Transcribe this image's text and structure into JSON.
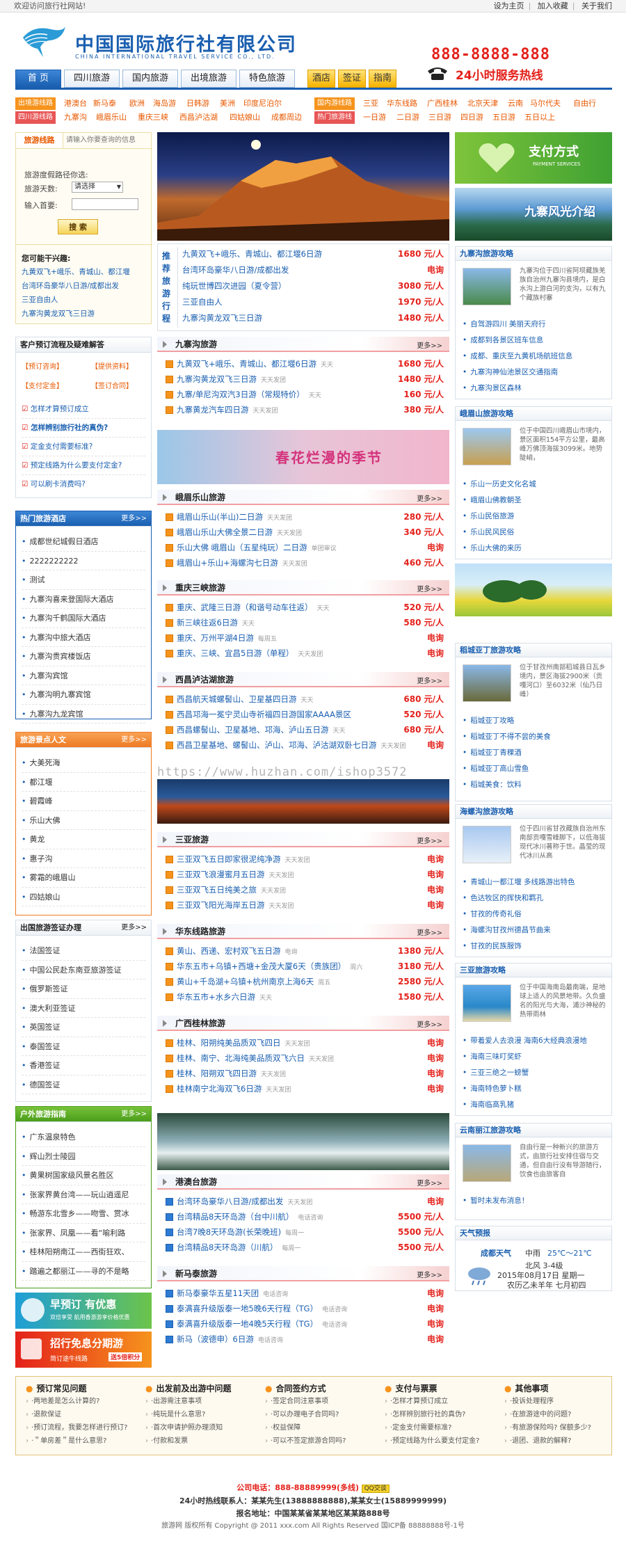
{
  "topbar": {
    "welcome": "欢迎访问旅行社网站!",
    "links": [
      "设为主页",
      "加入收藏",
      "关于我们"
    ]
  },
  "header": {
    "title_cn": "中国国际旅行社有限公司",
    "title_en": "CHINA INTERNATIONAL TRAVEL SERVICE CO., LTD.",
    "phone": "888-8888-888",
    "phone_label": "24小时服务热线"
  },
  "nav": [
    "首 页",
    "四川旅游",
    "国内旅游",
    "出境旅游",
    "特色旅游",
    "酒店",
    "签证",
    "指南"
  ],
  "routes": {
    "row1_label": "出境游线路",
    "row1": [
      "港澳台",
      "新马泰",
      "欧洲",
      "海岛游",
      "日韩游",
      "美洲",
      "印度尼泊尔"
    ],
    "row1b_label": "国内游线路",
    "row1b": [
      "三亚",
      "华东线路",
      "广西桂林",
      "北京天津",
      "云南",
      "马尔代夫",
      "自由行"
    ],
    "row2_label": "四川游线路",
    "row2": [
      "九寨沟",
      "峨眉乐山",
      "重庆三峡",
      "西昌泸沽湖",
      "四姑娘山",
      "成都周边"
    ],
    "row2b_label": "热门旅游线",
    "row2b": [
      "一日游",
      "二日游",
      "三日游",
      "四日游",
      "五日游",
      "五日以上"
    ]
  },
  "search": {
    "tab1": "旅游线路",
    "tab2": "请输入你要查询的信息",
    "prompt": "旅游度假路径你选:",
    "days_label": "旅游天数:",
    "days_value": "请选择",
    "keyword_label": "输入首要:",
    "btn": "搜 索"
  },
  "recommend": {
    "title": "您可能干兴趣:",
    "items": [
      "九黄双飞+峨乐、青城山、都江堰",
      "台湾环岛豪华八日游/成都出发",
      "三亚自由人",
      "九寨沟黄龙双飞三日游"
    ]
  },
  "process": {
    "title": "客户预订流程及疑难解答",
    "steps": [
      "预订咨询",
      "提供资料",
      "支付定金",
      "签订合同"
    ],
    "faq": [
      "怎样才算预订成立",
      "怎样辨别旅行社的真伪?",
      "定金支付需要标准?",
      "预定线路为什么要支付定金?",
      "可以刷卡消费吗?"
    ]
  },
  "hotels": {
    "title": "热门旅游酒店",
    "more": "更多>>",
    "items": [
      "成都世纪城假日酒店",
      "2222222222",
      "测试",
      "九寨沟喜来登国际大酒店",
      "九寨沟千鹤国际大酒店",
      "九寨沟中旅大酒店",
      "九寨沟贵宾楼饭店",
      "九寨沟宾馆",
      "九寨沟明九寨宾馆",
      "九寨沟九龙宾馆"
    ]
  },
  "spots": {
    "title": "旅游景点人文",
    "more": "更多>>",
    "items": [
      "大美死海",
      "都江堰",
      "碧霞峰",
      "乐山大佛",
      "黄龙",
      "惠子沟",
      "雾霜的峨眉山",
      "四姑娘山"
    ]
  },
  "visa": {
    "title": "出国旅游签证办理",
    "more": "更多>>",
    "items": [
      "法国签证",
      "中国公民赴东南亚旅游签证",
      "俄罗斯签证",
      "澳大利亚签证",
      "英国签证",
      "泰国签证",
      "香港签证",
      "德国签证"
    ]
  },
  "guide": {
    "title": "户外旅游指南",
    "more": "更多>>",
    "items": [
      "广东温泉特色",
      "辉山烈士陵园",
      "黄果树国家级风景名胜区",
      "张家界黄台湾——玩山逍遥尼",
      "畅游东北雪乡——吻雪、赏冰",
      "张家界、凤凰——看“喻利路",
      "桂林阳朔南江——西街狂欢、",
      "踏遍之都丽江——寻的不是略"
    ]
  },
  "promo": {
    "a_title": "早预订 有优惠",
    "a_sub": "双倍享受  航用香游游享价格优惠",
    "b_title": "招行免息分期游",
    "b_sub": "简订途牛线路",
    "b_tag": "送5倍积分"
  },
  "featured": {
    "label": "推荐旅游行程",
    "rows": [
      {
        "name": "九黄双飞+峨乐、青城山、都江堰6日游",
        "price": "1680 元/人"
      },
      {
        "name": "台湾环岛豪华八日游/成都出发",
        "price": "电询"
      },
      {
        "name": "纯玩世博四次进园（夏令营）",
        "price": "3080 元/人"
      },
      {
        "name": "三亚自由人",
        "price": "1970 元/人"
      },
      {
        "name": "九寨沟黄龙双飞三日游",
        "price": "1480 元/人"
      }
    ]
  },
  "sections": [
    {
      "title": "九寨沟旅游",
      "more": "更多>>",
      "rows": [
        {
          "n": "九黄双飞+峨乐、青城山、都江堰6日游",
          "t": "天天",
          "p": "1680 元/人"
        },
        {
          "n": "九寨沟黄龙双飞三日游",
          "t": "天天发团",
          "p": "1480 元/人"
        },
        {
          "n": "九寨/单尼沟双汽3日游（常规特价）",
          "t": "天天",
          "p": "160 元/人"
        },
        {
          "n": "九寨黄龙汽车四日游",
          "t": "天天发团",
          "p": "380 元/人"
        }
      ]
    },
    {
      "title": "峨眉乐山旅游",
      "more": "更多>>",
      "rows": [
        {
          "n": "峨眉山乐山(半山)二日游",
          "t": "天天发团",
          "p": "280 元/人"
        },
        {
          "n": "峨眉山乐山大佛全景二日游",
          "t": "天天发团",
          "p": "340 元/人"
        },
        {
          "n": "乐山大佛 峨眉山（五星纯玩）二日游",
          "t": "单团审议",
          "p": "电询"
        },
        {
          "n": "峨眉山+乐山+海螺沟七日游",
          "t": "天天发团",
          "p": "460 元/人"
        }
      ]
    },
    {
      "title": "重庆三峡旅游",
      "more": "更多>>",
      "rows": [
        {
          "n": "重庆、武隆三日游（和谐号动车往返）",
          "t": "天天",
          "p": "520 元/人"
        },
        {
          "n": "新三峡往返6日游",
          "t": "天天",
          "p": "580 元/人"
        },
        {
          "n": "重庆、万州平湖4日游",
          "t": "每周五",
          "p": "电询"
        },
        {
          "n": "重庆、三峡、宜昌5日游（单程）",
          "t": "天天发团",
          "p": "电询"
        }
      ]
    },
    {
      "title": "西昌泸沽湖旅游",
      "more": "更多>>",
      "rows": [
        {
          "n": "西昌航天城螺髻山、卫星基四日游",
          "t": "天天",
          "p": "680 元/人"
        },
        {
          "n": "西昌邛海一冕宁灵山寺祈福四日游国家AAAA景区",
          "t": "",
          "p": "520 元/人"
        },
        {
          "n": "西昌螺髻山、卫星基地、邛海、泸山五日游",
          "t": "天天",
          "p": "680 元/人"
        },
        {
          "n": "西昌卫星基地、螺髻山、泸山、邛海、泸沽湖双卧七日游",
          "t": "天天发团",
          "p": "电询"
        }
      ]
    },
    {
      "title": "三亚旅游",
      "more": "更多>>",
      "rows": [
        {
          "n": "三亚双飞五日即家很泥纯净游",
          "t": "天天发团",
          "p": "电询"
        },
        {
          "n": "三亚双飞浪漫蜜月五日游",
          "t": "天天发团",
          "p": "电询"
        },
        {
          "n": "三亚双飞五日纯美之旅",
          "t": "天天发团",
          "p": "电询"
        },
        {
          "n": "三亚双飞阳光海岸五日游",
          "t": "天天发团",
          "p": "电询"
        }
      ]
    },
    {
      "title": "华东线路旅游",
      "more": "更多>>",
      "rows": [
        {
          "n": "黄山、西递、宏村双飞五日游",
          "t": "电询",
          "p": "1380 元/人"
        },
        {
          "n": "华东五市+乌镇+西塘+金茂大厦6天（贵族团）",
          "t": "周六",
          "p": "3180 元/人"
        },
        {
          "n": "黄山+千岛湖+乌镇+杭州南京上海6天",
          "t": "周五",
          "p": "2580 元/人"
        },
        {
          "n": "华东五市+水乡六日游",
          "t": "天天",
          "p": "1580 元/人"
        }
      ]
    },
    {
      "title": "广西桂林旅游",
      "more": "更多>>",
      "rows": [
        {
          "n": "桂林、阳朔纯美品质双飞四日",
          "t": "天天发团",
          "p": "电询"
        },
        {
          "n": "桂林、南宁、北海纯美品质双飞六日",
          "t": "天天发团",
          "p": "电询"
        },
        {
          "n": "桂林、阳朔双飞四日游",
          "t": "天天发团",
          "p": "电询"
        },
        {
          "n": "桂林南宁北海双飞6日游",
          "t": "天天发团",
          "p": "电询"
        }
      ]
    },
    {
      "title": "港澳台旅游",
      "more": "更多>>",
      "rows": [
        {
          "n": "台湾环岛豪华八日游/成都出发",
          "t": "天天发团",
          "p": "电询"
        },
        {
          "n": "台湾精品8天环岛游（台中川航）",
          "t": "电话咨询",
          "p": "5500 元/人"
        },
        {
          "n": "台湾7晚8天环岛游(长荣晚班)",
          "t": "每周一",
          "p": "5500 元/人"
        },
        {
          "n": "台湾精品8天环岛游（川航）",
          "t": "每周一",
          "p": "5500 元/人"
        }
      ]
    },
    {
      "title": "新马泰旅游",
      "more": "更多>>",
      "rows": [
        {
          "n": "新马泰豪华五星11天团",
          "t": "电话咨询",
          "p": "电询"
        },
        {
          "n": "泰满喜升级版泰一地5晚6天行程（TG）",
          "t": "电话咨询",
          "p": "电询"
        },
        {
          "n": "泰满喜升级版泰一地4晚5天行程（TG）",
          "t": "电话咨询",
          "p": "电询"
        },
        {
          "n": "新马（波德申）6日游",
          "t": "电话咨询",
          "p": "电询"
        }
      ]
    }
  ],
  "banner_text": "春花烂漫的季节",
  "watermark": "https://www.huzhan.com/ishop3572",
  "right": {
    "pay_title": "支付方式",
    "pay_sub": "PAYMENT SERVICES",
    "scene_title": "九寨风光介绍",
    "guides": [
      {
        "title": "九寨沟旅游攻略",
        "desc": "九寨沟位于四川省阿坝藏族羌族自治州九寨沟县境内，是白水沟上游白河的支沟，以有九个藏族村寨",
        "items": [
          "自驾游四川 美丽天府行",
          "成都到各景区班车信息",
          "成都、重庆至九黄机场航班信息",
          "九寨沟神仙池景区交通指南",
          "九寨沟景区森林"
        ]
      },
      {
        "title": "峨眉山旅游攻略",
        "desc": "位于中国四川峨眉山市境内，景区面积154平方公里，最高峰万佛顶海拔3099米。地势陡峭，",
        "items": [
          "乐山一历史文化名城",
          "峨眉山佛教朝圣",
          "乐山民俗旅游",
          "乐山民风民俗",
          "乐山大佛的来历"
        ]
      },
      {
        "title": "稻城亚丁旅游攻略",
        "desc": "位于甘孜州南部稻城县日瓦乡境内，景区海拔2900米（贡嘎河口）至6032米（仙乃日峰）",
        "items": [
          "稻城亚丁攻略",
          "稻城亚丁不得不尝的美食",
          "稻城亚丁青稞酒",
          "稻城亚丁高山雪鱼",
          "稻城美食：饮料"
        ]
      },
      {
        "title": "海螺沟旅游攻略",
        "desc": "位于四川省甘孜藏族自治州东南部贡嘎雪峰脚下，以低海拔现代冰川著称于世。晶莹的现代冰川从高",
        "items": [
          "青城山一都江堰 多线路游出特色",
          "色达牧区的挥快和羁孔",
          "甘孜的传奇礼俗",
          "海螺沟甘孜州德昌节曲来",
          "甘孜的民族服饰"
        ]
      },
      {
        "title": "三亚旅游攻略",
        "desc": "位于中国海南岛最南端，是地球上适人的风景地带。久负盛名的阳光与大海，浦沙神秘的热带雨林",
        "items": [
          "带着爱人去浪漫 海南6大经典浪漫地",
          "海南三味叮奖虾",
          "三亚三绝之一螃蟹",
          "海南特色萝卜糕",
          "海南临高乳猪"
        ]
      },
      {
        "title": "云南丽江旅游攻略",
        "desc": "自由行是一种新兴的旅游方式，由旅行社安排住宿与交通，但自由行没有导游随行，饮食也由旅客自",
        "items": [
          "暂时未发布消息！"
        ]
      }
    ],
    "weather": {
      "title": "天气预报",
      "city": "成都天气",
      "cond": "中雨",
      "temp": "25℃～21℃",
      "wind": "北风 3-4级",
      "date": "2015年08月17日 星期一",
      "lunar": "农历乙未羊年 七月初四"
    }
  },
  "faqcols": [
    {
      "h": "预订常见问题",
      "items": [
        "·两地差是怎么计算的?",
        "·退款保证",
        "·预订流程，我要怎样进行预订?",
        "·＂单房差＂是什么意思?"
      ]
    },
    {
      "h": "出发前及出游中问题",
      "items": [
        "·出游需注意事项",
        "·纯玩是什么意思?",
        "·首次申请护照办理须知",
        "·付款和发票"
      ]
    },
    {
      "h": "合同签约方式",
      "items": [
        "·签定合同注意事项",
        "·可以办理电子合同吗?",
        "·权益保障",
        "·可以不签定旅游合同吗?"
      ]
    },
    {
      "h": "支付与票票",
      "items": [
        "·怎样才算预订成立",
        "·怎样辨别旅行社的真伪?",
        "·定金支付需要标准?",
        "·预定线路为什么要支付定金?"
      ]
    },
    {
      "h": "其他事项",
      "items": [
        "·投诉处理程序",
        "·在旅游途中的问题?",
        "·有旅游保险吗? 保额多少?",
        "·退团、退款的解释?"
      ]
    }
  ],
  "footer": {
    "phone_label": "公司电话：",
    "phone": "888-88889999(多线)",
    "qq": "QQ交谈",
    "hotline": "24小时热线联系人：某某先生(13888888888),某某女士(15889999999)",
    "addr": "报名地址：中国某某省某某地区某某路888号",
    "copy": "旅游网 版权所有 Copyright @ 2011 xxx.com All Rights Reserved 国ICP备 88888888号-1号"
  }
}
